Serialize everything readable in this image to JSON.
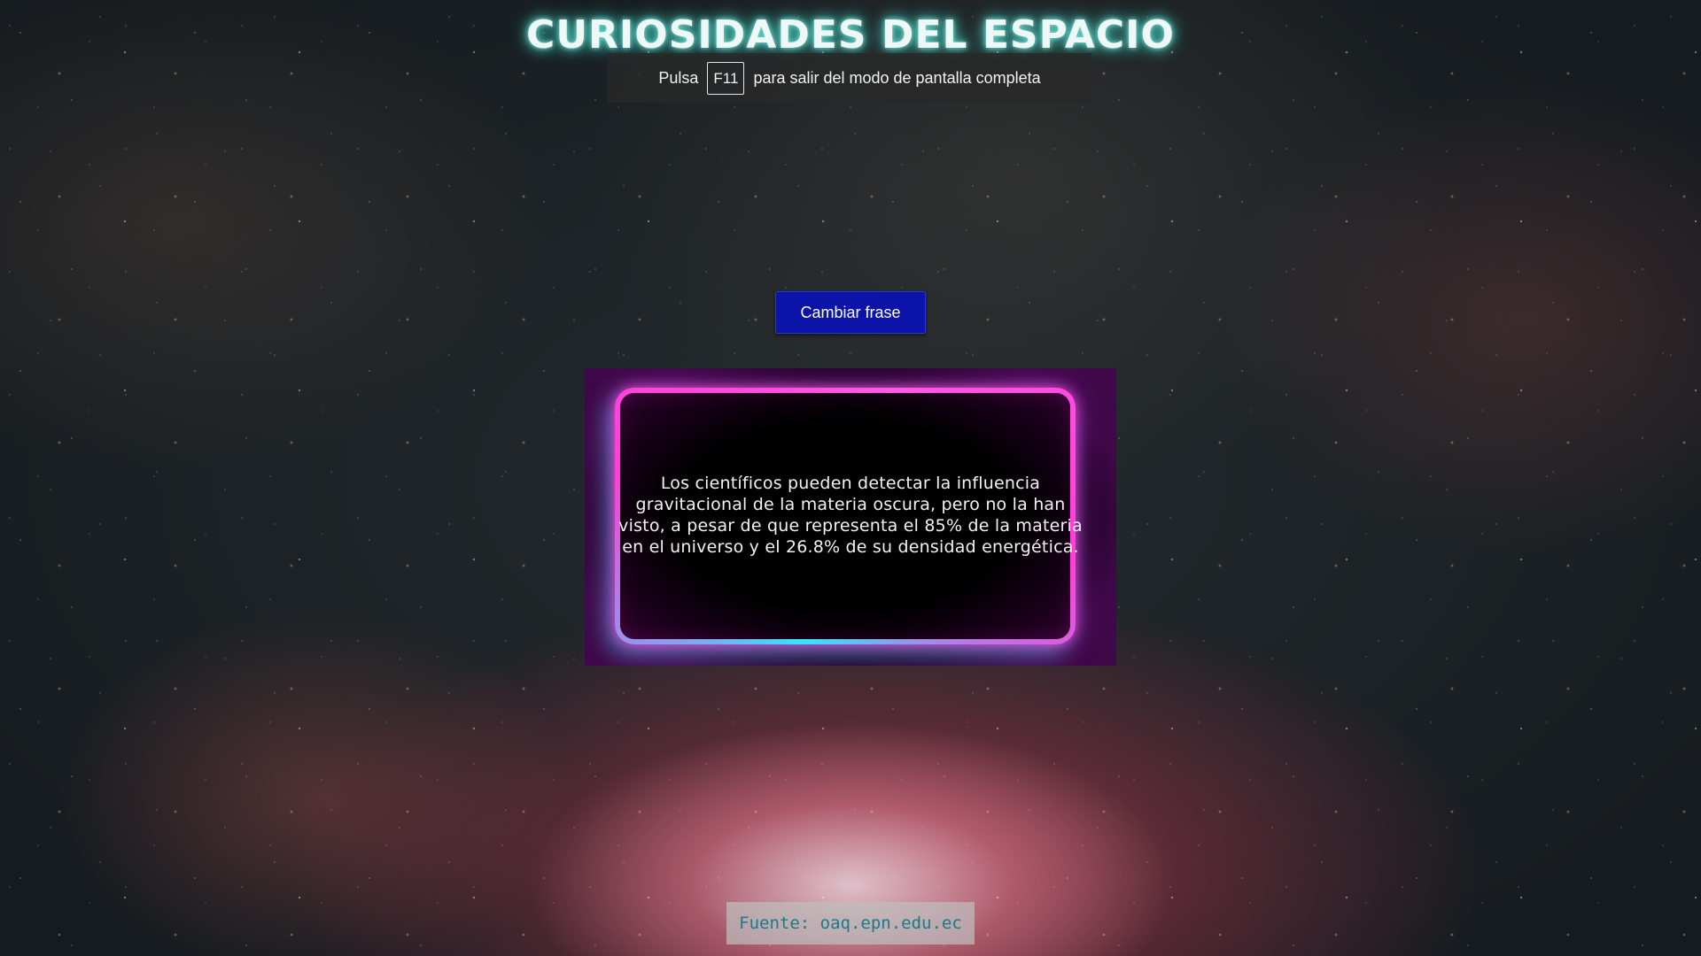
{
  "header": {
    "title": "CURIOSIDADES DEL ESPACIO"
  },
  "fullscreen_notice": {
    "prefix": "Pulsa",
    "key": "F11",
    "suffix": "para salir del modo de pantalla completa"
  },
  "controls": {
    "change_phrase_label": "Cambiar frase"
  },
  "phrase": {
    "text": "Los científicos pueden detectar la influencia gravitacional de la materia oscura, pero no la han visto, a pesar de que representa el 85% de la materia en el universo y el 26.8% de su densidad energética."
  },
  "footer": {
    "source": "Fuente: oaq.epn.edu.ec"
  },
  "colors": {
    "title_glow": "#4cc9bd",
    "button_bg": "#0c13a8",
    "neon_pink": "#ff3ed6",
    "neon_cyan": "#35e6ff",
    "source_text": "#1a7a8a"
  }
}
